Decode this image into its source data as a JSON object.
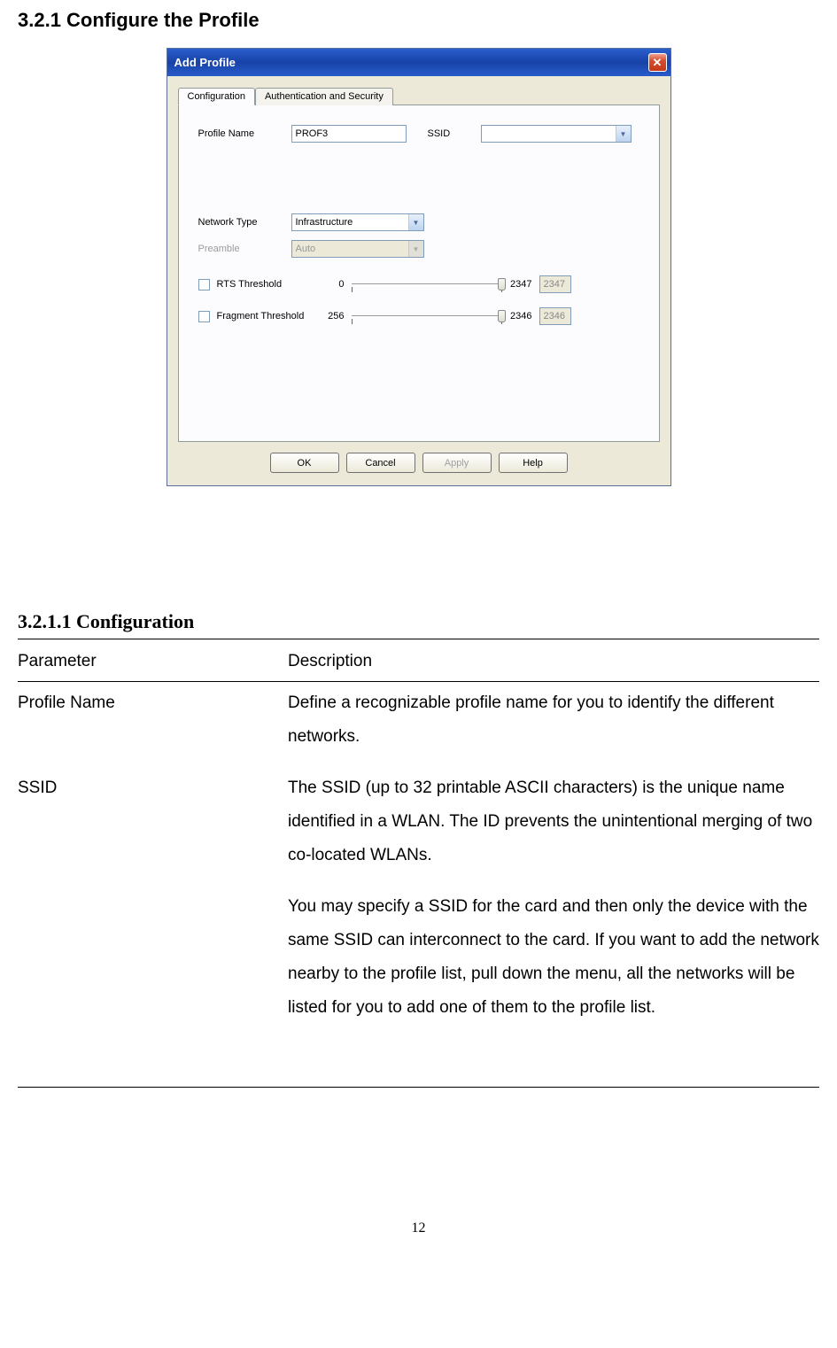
{
  "section_title": "3.2.1  Configure the Profile",
  "dialog": {
    "title": "Add Profile",
    "tabs": [
      "Configuration",
      "Authentication and Security"
    ],
    "profile_name_label": "Profile Name",
    "profile_name_value": "PROF3",
    "ssid_label": "SSID",
    "ssid_value": "",
    "network_type_label": "Network Type",
    "network_type_value": "Infrastructure",
    "preamble_label": "Preamble",
    "preamble_value": "Auto",
    "rts_label": "RTS Threshold",
    "rts_min": "0",
    "rts_max": "2347",
    "rts_value": "2347",
    "fragment_label": "Fragment Threshold",
    "fragment_min": "256",
    "fragment_max": "2346",
    "fragment_value": "2346",
    "buttons": {
      "ok": "OK",
      "cancel": "Cancel",
      "apply": "Apply",
      "help": "Help"
    }
  },
  "subsection_title": "3.2.1.1    Configuration",
  "table": {
    "header_param": "Parameter",
    "header_desc": "Description",
    "rows": [
      {
        "param": "Profile Name",
        "desc": "Define a recognizable profile name for you to identify the different networks."
      },
      {
        "param": "SSID",
        "desc1": "The SSID (up to 32 printable ASCII characters) is the unique name identified in a WLAN. The ID prevents the unintentional merging of two co-located WLANs.",
        "desc2": "You may specify a SSID for the card and then only the device with the same SSID can interconnect to the card. If you want to add the network nearby to the profile list, pull down the menu, all the networks will be listed for you to add one of them to the profile list."
      }
    ]
  },
  "page_number": "12"
}
